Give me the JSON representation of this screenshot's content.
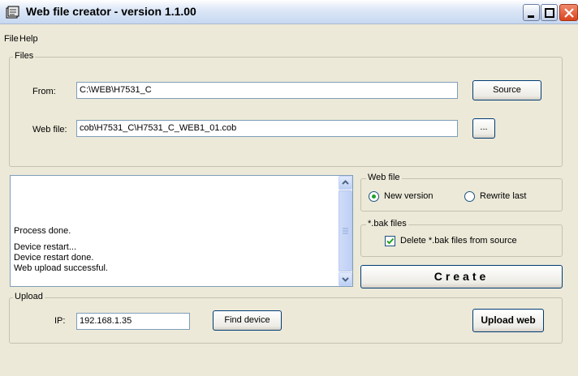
{
  "window": {
    "title": "Web file creator - version 1.1.00",
    "icon": "file-creator-icon",
    "controls": [
      "minimize-icon",
      "maximize-icon",
      "close-icon"
    ]
  },
  "menu": {
    "file": "File",
    "help": "Help"
  },
  "files_group": {
    "label": "Files",
    "from_label": "From:",
    "from_value": "C:\\WEB\\H7531_C",
    "source_button": "Source",
    "webfile_label": "Web file:",
    "webfile_value": "cob\\H7531_C\\H7531_C_WEB1_01.cob",
    "browse_button": "..."
  },
  "log": {
    "lines": [
      "Process done.",
      "",
      "Device restart...",
      "Device restart done.",
      "Web upload successful."
    ]
  },
  "webfile_group": {
    "label": "Web file",
    "new_version": "New version",
    "rewrite_last": "Rewrite last",
    "selected": "New version"
  },
  "bak_group": {
    "label": "*.bak files",
    "delete_label": "Delete *.bak files from source",
    "checked": true
  },
  "create_button": "Create",
  "upload_group": {
    "label": "Upload",
    "ip_label": "IP:",
    "ip_value": "192.168.1.35",
    "find_button": "Find device",
    "upload_button": "Upload web"
  }
}
